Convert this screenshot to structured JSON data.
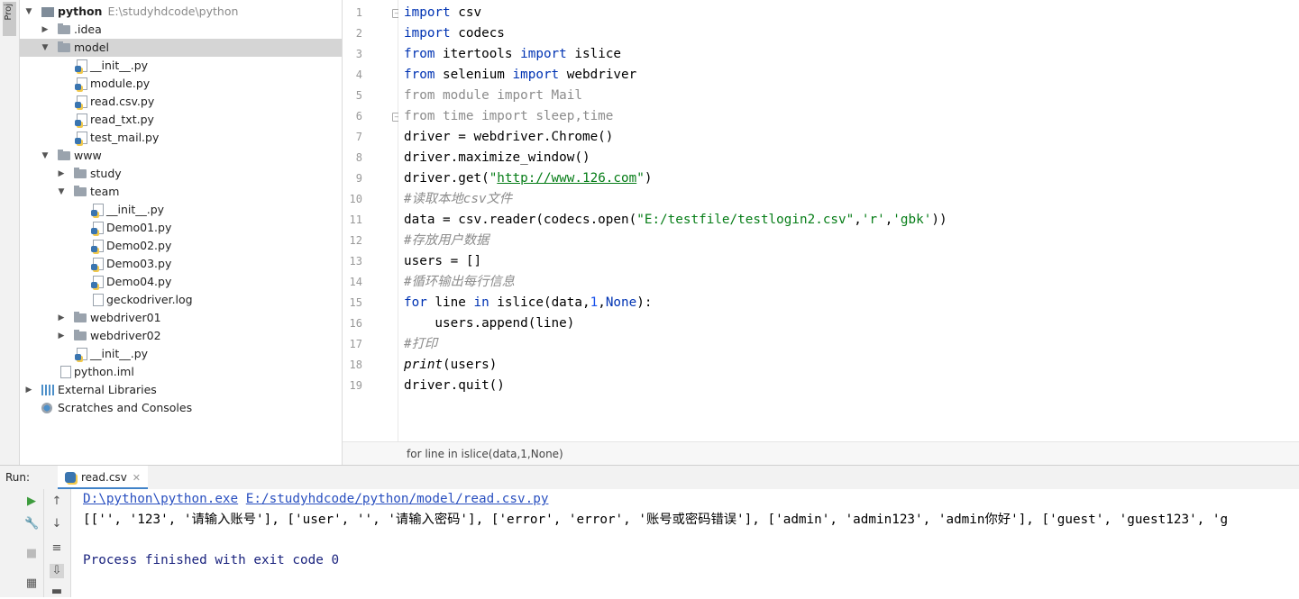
{
  "left_strip": {
    "project_label": "Proj"
  },
  "tree": {
    "root": {
      "name": "python",
      "path": "E:\\studyhdcode\\python"
    },
    "items": [
      {
        "label": ".idea"
      },
      {
        "label": "model"
      },
      {
        "label": "__init__.py"
      },
      {
        "label": "module.py"
      },
      {
        "label": "read.csv.py"
      },
      {
        "label": "read_txt.py"
      },
      {
        "label": "test_mail.py"
      },
      {
        "label": "www"
      },
      {
        "label": "study"
      },
      {
        "label": "team"
      },
      {
        "label": "__init__.py"
      },
      {
        "label": "Demo01.py"
      },
      {
        "label": "Demo02.py"
      },
      {
        "label": "Demo03.py"
      },
      {
        "label": "Demo04.py"
      },
      {
        "label": "geckodriver.log"
      },
      {
        "label": "webdriver01"
      },
      {
        "label": "webdriver02"
      },
      {
        "label": "__init__.py"
      },
      {
        "label": "python.iml"
      },
      {
        "label": "External Libraries"
      },
      {
        "label": "Scratches and Consoles"
      }
    ]
  },
  "editor": {
    "line_numbers": [
      "1",
      "2",
      "3",
      "4",
      "5",
      "6",
      "7",
      "8",
      "9",
      "10",
      "11",
      "12",
      "13",
      "14",
      "15",
      "16",
      "17",
      "18",
      "19"
    ],
    "code": {
      "l1_kw": "import",
      "l1_rest": " csv",
      "l2_kw": "import",
      "l2_rest": " codecs",
      "l3_kw1": "from",
      "l3_mod": " itertools ",
      "l3_kw2": "import",
      "l3_rest": " islice",
      "l4_kw1": "from",
      "l4_mod": " selenium ",
      "l4_kw2": "import",
      "l4_rest": " webdriver",
      "l5": "from module import Mail",
      "l6": "from time import sleep,time",
      "l7": "driver = webdriver.Chrome()",
      "l8": "driver.maximize_window()",
      "l9_a": "driver.get(",
      "l9_q1": "\"",
      "l9_url": "http://www.126.com",
      "l9_q2": "\"",
      "l9_b": ")",
      "l10": "#读取本地csv文件",
      "l11_a": "data = csv.reader(codecs.open(",
      "l11_s1": "\"E:/testfile/testlogin2.csv\"",
      "l11_c1": ",",
      "l11_s2": "'r'",
      "l11_c2": ",",
      "l11_s3": "'gbk'",
      "l11_b": "))",
      "l12": "#存放用户数据",
      "l13": "users = []",
      "l14": "#循环输出每行信息",
      "l15_kw1": "for",
      "l15_a": " line ",
      "l15_kw2": "in",
      "l15_b": " islice(data,",
      "l15_n": "1",
      "l15_c": ",",
      "l15_none": "None",
      "l15_d": "):",
      "l16": "    users.append(line)",
      "l17": "#打印",
      "l18_fn": "print",
      "l18_rest": "(users)",
      "l19": "driver.quit()"
    },
    "breadcrumb": "for line in islice(data,1,None)"
  },
  "run": {
    "label": "Run:",
    "tab": "read.csv",
    "cmd_python": "D:\\python\\python.exe",
    "cmd_script": "E:/studyhdcode/python/model/read.csv.py",
    "output": "[['', '123', '请输入账号'], ['user', '', '请输入密码'], ['error', 'error', '账号或密码错误'], ['admin', 'admin123', 'admin你好'], ['guest', 'guest123', 'g",
    "exit": "Process finished with exit code 0"
  }
}
